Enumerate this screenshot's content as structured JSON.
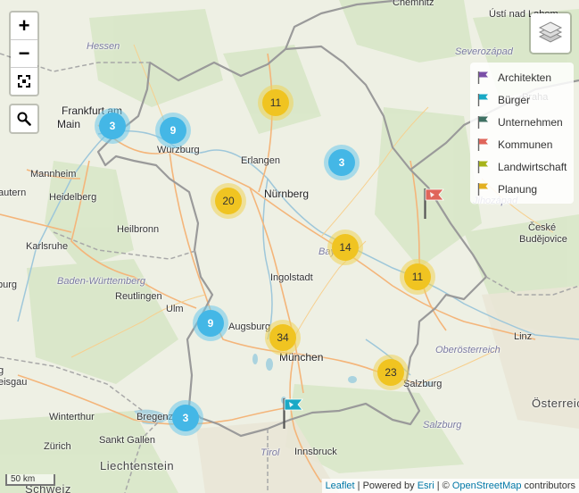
{
  "controls": {
    "zoom_in": "+",
    "zoom_out": "−"
  },
  "places": [
    {
      "name": "Chemnitz",
      "cls": "place"
    },
    {
      "name": "Ústí nad Labem",
      "cls": "place"
    },
    {
      "name": "Severozápad",
      "cls": "place region"
    },
    {
      "name": "Hessen",
      "cls": "place region"
    },
    {
      "name": "Frankfurt am",
      "cls": "place big"
    },
    {
      "name": "Main",
      "cls": "place big"
    },
    {
      "name": "Praha",
      "cls": "place"
    },
    {
      "name": "Würzburg",
      "cls": "place"
    },
    {
      "name": "Mannheim",
      "cls": "place"
    },
    {
      "name": "Erlangen",
      "cls": "place"
    },
    {
      "name": "Heidelberg",
      "cls": "place"
    },
    {
      "name": "autern",
      "cls": "place"
    },
    {
      "name": "Nürnberg",
      "cls": "place big"
    },
    {
      "name": "Jihozápad",
      "cls": "place region"
    },
    {
      "name": "Karlsruhe",
      "cls": "place"
    },
    {
      "name": "Heilbronn",
      "cls": "place"
    },
    {
      "name": "Bay",
      "cls": "place region"
    },
    {
      "name": "České",
      "cls": "place"
    },
    {
      "name": "Budějovice",
      "cls": "place"
    },
    {
      "name": "burg",
      "cls": "place"
    },
    {
      "name": "Baden-Württemberg",
      "cls": "place region"
    },
    {
      "name": "Reutlingen",
      "cls": "place"
    },
    {
      "name": "Ingolstadt",
      "cls": "place"
    },
    {
      "name": "Ulm",
      "cls": "place"
    },
    {
      "name": "Augsburg",
      "cls": "place"
    },
    {
      "name": "Linz",
      "cls": "place"
    },
    {
      "name": "Oberösterreich",
      "cls": "place region"
    },
    {
      "name": "München",
      "cls": "place big"
    },
    {
      "name": "Salzburg",
      "cls": "place"
    },
    {
      "name": "Österreich",
      "cls": "place country"
    },
    {
      "name": "Winterthur",
      "cls": "place"
    },
    {
      "name": "Bregenz",
      "cls": "place"
    },
    {
      "name": "Zürich",
      "cls": "place"
    },
    {
      "name": "Sankt Gallen",
      "cls": "place"
    },
    {
      "name": "Salzburg",
      "cls": "place region"
    },
    {
      "name": "Tirol",
      "cls": "place region"
    },
    {
      "name": "Innsbruck",
      "cls": "place"
    },
    {
      "name": "Liechtenstein",
      "cls": "place country"
    },
    {
      "name": "Schweiz",
      "cls": "place country"
    },
    {
      "name": "g",
      "cls": "place"
    },
    {
      "name": "eisgau",
      "cls": "place"
    }
  ],
  "legend": [
    {
      "label": "Architekten",
      "color": "#7b4fa8"
    },
    {
      "label": "Bürger",
      "color": "#19a9c6"
    },
    {
      "label": "Unternehmen",
      "color": "#3e7062"
    },
    {
      "label": "Kommunen",
      "color": "#e0655a"
    },
    {
      "label": "Landwirtschaft",
      "color": "#a6b319"
    },
    {
      "label": "Planung",
      "color": "#e3b021"
    }
  ],
  "clusters": [
    {
      "count": "3",
      "color": "blue"
    },
    {
      "count": "9",
      "color": "blue"
    },
    {
      "count": "11",
      "color": "yellow"
    },
    {
      "count": "3",
      "color": "blue"
    },
    {
      "count": "20",
      "color": "yellow"
    },
    {
      "count": "14",
      "color": "yellow"
    },
    {
      "count": "11",
      "color": "yellow"
    },
    {
      "count": "9",
      "color": "blue"
    },
    {
      "count": "34",
      "color": "yellow"
    },
    {
      "count": "23",
      "color": "yellow"
    },
    {
      "count": "3",
      "color": "blue"
    }
  ],
  "markers": [
    {
      "category": "Kommunen",
      "color": "#e0655a"
    },
    {
      "category": "Bürger",
      "color": "#19a9c6"
    }
  ],
  "scale_label": "50 km",
  "attribution": {
    "leaflet": "Leaflet",
    "sep1": " | Powered by ",
    "esri": "Esri",
    "sep2": " | © ",
    "osm": "OpenStreetMap",
    "tail": " contributors"
  },
  "icons": {
    "zoom_in": "plus-icon",
    "zoom_out": "minus-icon",
    "fullscreen": "fullscreen-icon",
    "search": "search-icon",
    "layers": "layers-icon",
    "flag": "flag-icon"
  }
}
